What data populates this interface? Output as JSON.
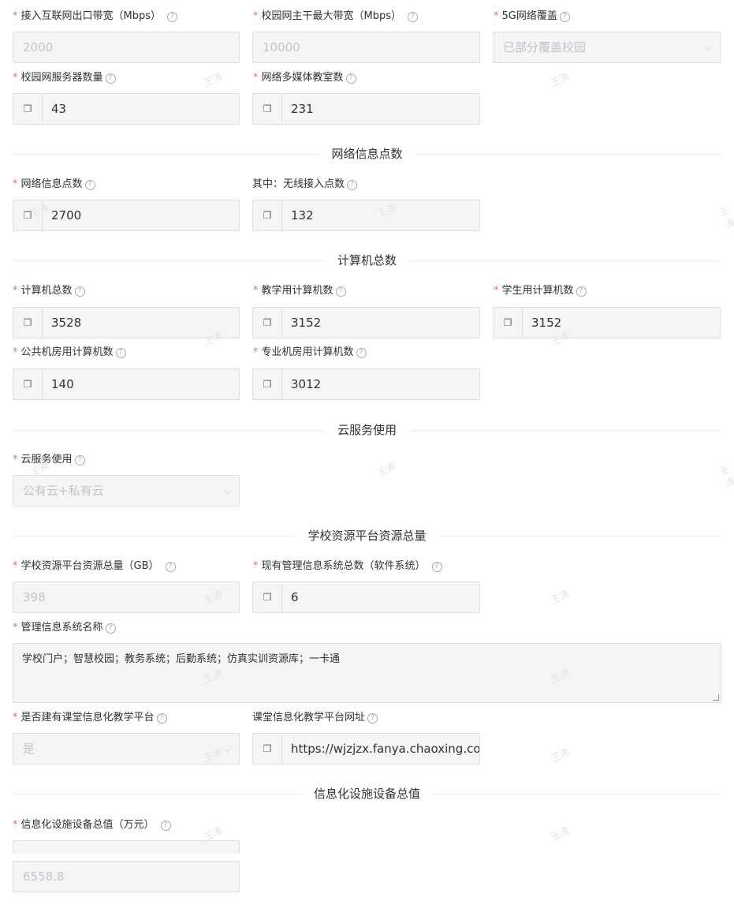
{
  "fields": {
    "internet_bw": {
      "label": "接入互联网出口带宽（Mbps）",
      "value": "2000"
    },
    "campus_bw": {
      "label": "校园网主干最大带宽（Mbps）",
      "value": "10000"
    },
    "coverage_5g": {
      "label": "5G网络覆盖",
      "value": "已部分覆盖校园"
    },
    "servers": {
      "label": "校园网服务器数量",
      "value": "43"
    },
    "mm_rooms": {
      "label": "网络多媒体教室数",
      "value": "231"
    },
    "info_points": {
      "label": "网络信息点数",
      "value": "2700"
    },
    "wireless_points": {
      "label": "其中：无线接入点数",
      "value": "132"
    },
    "computers_total": {
      "label": "计算机总数",
      "value": "3528"
    },
    "teaching_computers": {
      "label": "教学用计算机数",
      "value": "3152"
    },
    "student_computers": {
      "label": "学生用计算机数",
      "value": "3152"
    },
    "public_lab_computers": {
      "label": "公共机房用计算机数",
      "value": "140"
    },
    "special_lab_computers": {
      "label": "专业机房用计算机数",
      "value": "3012"
    },
    "cloud_usage": {
      "label": "云服务使用",
      "value": "公有云+私有云"
    },
    "platform_total": {
      "label": "学校资源平台资源总量（GB）",
      "value": "398"
    },
    "mis_count": {
      "label": "现有管理信息系统总数（软件系统）",
      "value": "6"
    },
    "mis_names": {
      "label": "管理信息系统名称",
      "value": "学校门户；智慧校园；教务系统；后勤系统；仿真实训资源库；一卡通"
    },
    "has_platform": {
      "label": "是否建有课堂信息化教学平台",
      "value": "是"
    },
    "platform_url": {
      "label": "课堂信息化教学平台网址",
      "value": "https://wjzjzx.fanya.chaoxing.co"
    },
    "equipment_value": {
      "label": "信息化设施设备总值（万元）",
      "value": "6558.8"
    }
  },
  "sections": {
    "info_points": "网络信息点数",
    "computers": "计算机总数",
    "cloud": "云服务使用",
    "platform": "学校资源平台资源总量",
    "equipment": "信息化设施设备总值"
  },
  "common": {
    "required_mark": "*",
    "help_icon": "?",
    "copy_icon": "copy-icon",
    "chevron": "⌵"
  },
  "watermark": "王涛"
}
